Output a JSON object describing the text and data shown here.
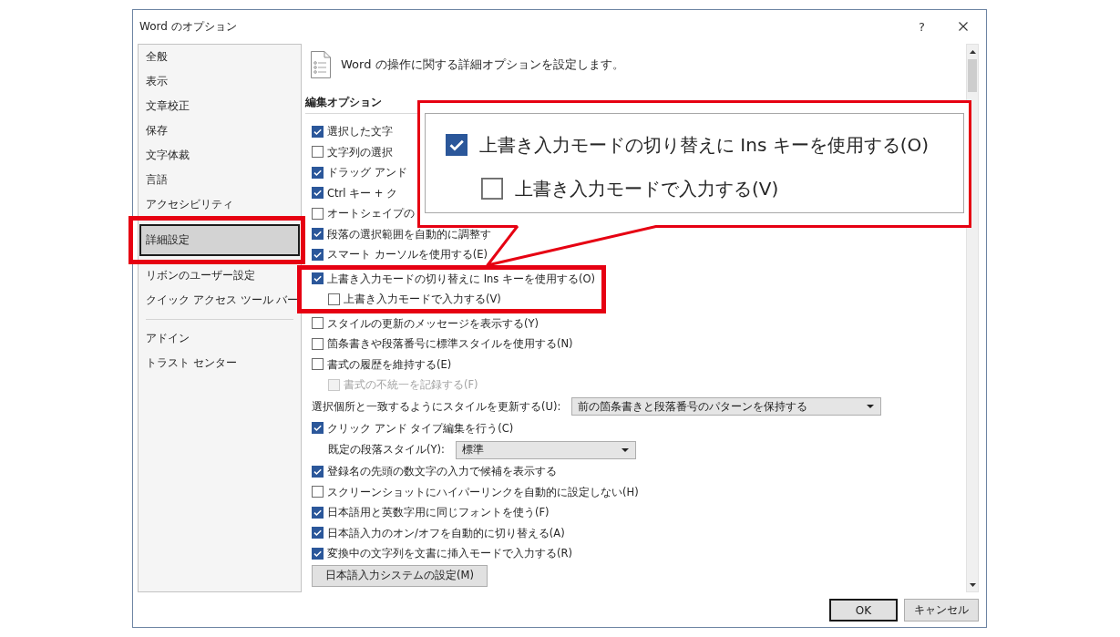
{
  "window": {
    "title": "Word のオプション",
    "help": "?"
  },
  "sidebar": {
    "groups": [
      {
        "items": [
          {
            "label": "全般",
            "selected": false,
            "highlighted": false
          },
          {
            "label": "表示",
            "selected": false,
            "highlighted": false
          },
          {
            "label": "文章校正",
            "selected": false,
            "highlighted": false
          },
          {
            "label": "保存",
            "selected": false,
            "highlighted": false
          },
          {
            "label": "文字体裁",
            "selected": false,
            "highlighted": false
          },
          {
            "label": "言語",
            "selected": false,
            "highlighted": false
          },
          {
            "label": "アクセシビリティ",
            "selected": false,
            "highlighted": false
          },
          {
            "label": "詳細設定",
            "selected": true,
            "highlighted": true
          },
          {
            "label": "リボンのユーザー設定",
            "selected": false,
            "highlighted": false
          },
          {
            "label": "クイック アクセス ツール バー",
            "selected": false,
            "highlighted": false
          }
        ]
      },
      {
        "items": [
          {
            "label": "アドイン",
            "selected": false,
            "highlighted": false
          },
          {
            "label": "トラスト センター",
            "selected": false,
            "highlighted": false
          }
        ]
      }
    ]
  },
  "header": {
    "description": "Word の操作に関する詳細オプションを設定します。"
  },
  "section": {
    "title": "編集オプション",
    "options": [
      {
        "kind": "checkbox",
        "label": "選択した文字",
        "checked": true,
        "disabled": false,
        "highlighted": false
      },
      {
        "kind": "checkbox",
        "label": "文字列の選択",
        "checked": false,
        "disabled": false,
        "highlighted": false
      },
      {
        "kind": "checkbox",
        "label": "ドラッグ アンド",
        "checked": true,
        "disabled": false,
        "highlighted": false
      },
      {
        "kind": "checkbox",
        "label": "Ctrl キー + ク",
        "checked": true,
        "disabled": false,
        "highlighted": false
      },
      {
        "kind": "checkbox",
        "label": "オートシェイプの",
        "checked": false,
        "disabled": false,
        "highlighted": false
      },
      {
        "kind": "checkbox",
        "label": "段落の選択範囲を自動的に調整す",
        "checked": true,
        "disabled": false,
        "highlighted": false
      },
      {
        "kind": "checkbox",
        "label": "スマート カーソルを使用する(E)",
        "checked": true,
        "disabled": false,
        "highlighted": false
      },
      {
        "kind": "checkbox",
        "label": "上書き入力モードの切り替えに Ins キーを使用する(O)",
        "checked": true,
        "disabled": false,
        "highlighted": true,
        "children": [
          {
            "kind": "checkbox",
            "label": "上書き入力モードで入力する(V)",
            "checked": false,
            "disabled": false
          }
        ]
      },
      {
        "kind": "checkbox",
        "label": "スタイルの更新のメッセージを表示する(Y)",
        "checked": false,
        "disabled": false,
        "highlighted": false
      },
      {
        "kind": "checkbox",
        "label": "箇条書きや段落番号に標準スタイルを使用する(N)",
        "checked": false,
        "disabled": false,
        "highlighted": false
      },
      {
        "kind": "checkbox",
        "label": "書式の履歴を維持する(E)",
        "checked": false,
        "disabled": false,
        "highlighted": false,
        "children": [
          {
            "kind": "checkbox",
            "label": "書式の不統一を記録する(F)",
            "checked": false,
            "disabled": true
          }
        ]
      },
      {
        "kind": "dropdown",
        "label": "選択個所と一致するようにスタイルを更新する(U):",
        "value": "前の箇条書きと段落番号のパターンを保持する",
        "disabled": false,
        "highlighted": false
      },
      {
        "kind": "checkbox",
        "label": "クリック アンド タイプ編集を行う(C)",
        "checked": true,
        "disabled": false,
        "highlighted": false,
        "children": [
          {
            "kind": "dropdown",
            "label": "既定の段落スタイル(Y):",
            "value": "標準",
            "disabled": false
          }
        ]
      },
      {
        "kind": "checkbox",
        "label": "登録名の先頭の数文字の入力で候補を表示する",
        "checked": true,
        "disabled": false,
        "highlighted": false
      },
      {
        "kind": "checkbox",
        "label": "スクリーンショットにハイパーリンクを自動的に設定しない(H)",
        "checked": false,
        "disabled": false,
        "highlighted": false
      },
      {
        "kind": "checkbox",
        "label": "日本語用と英数字用に同じフォントを使う(F)",
        "checked": true,
        "disabled": false,
        "highlighted": false
      },
      {
        "kind": "checkbox",
        "label": "日本語入力のオン/オフを自動的に切り替える(A)",
        "checked": true,
        "disabled": false,
        "highlighted": false
      },
      {
        "kind": "checkbox",
        "label": "変換中の文字列を文書に挿入モードで入力する(R)",
        "checked": true,
        "disabled": false,
        "highlighted": false
      },
      {
        "kind": "button",
        "label": "日本語入力システムの設定(M)",
        "disabled": false,
        "highlighted": false
      }
    ]
  },
  "callout": {
    "options": [
      {
        "kind": "checkbox",
        "label": "上書き入力モードの切り替えに Ins キーを使用する(O)",
        "checked": true,
        "disabled": false,
        "children": [
          {
            "kind": "checkbox",
            "label": "上書き入力モードで入力する(V)",
            "checked": false,
            "disabled": false
          }
        ]
      }
    ]
  },
  "buttons": [
    {
      "label": "OK",
      "default": true
    },
    {
      "label": "キャンセル",
      "default": false
    }
  ]
}
